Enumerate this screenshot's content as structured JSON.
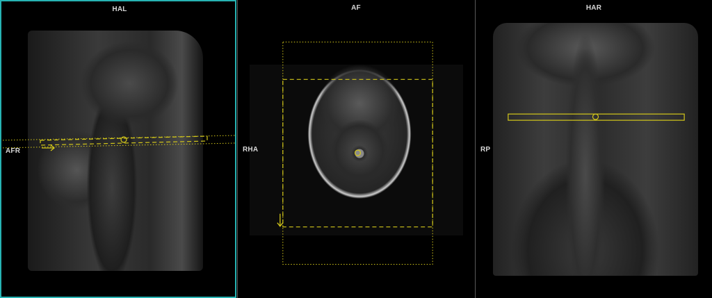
{
  "viewports": {
    "sagittal": {
      "top_label": "HAL",
      "left_label": "AFR"
    },
    "axial": {
      "top_label": "AF",
      "left_label": "RHA"
    },
    "coronal": {
      "top_label": "HAR",
      "left_label": "RP"
    }
  },
  "colors": {
    "active_border": "#27b3b3",
    "overlay": "#d4c81a",
    "label": "#d8d8d8",
    "divider": "#5a5a5a"
  }
}
